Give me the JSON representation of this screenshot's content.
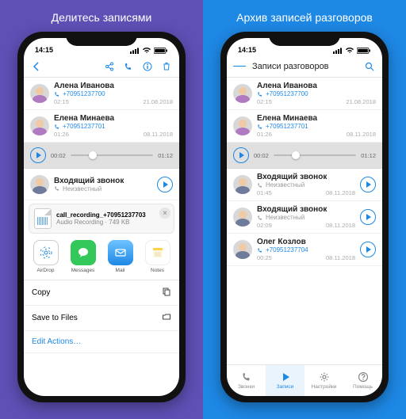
{
  "panels": {
    "left_title": "Делитесь записями",
    "right_title": "Архив записей разговоров"
  },
  "status_time": "14:15",
  "colors": {
    "accent": "#1e88e5"
  },
  "left": {
    "recordings": [
      {
        "name": "Алена Иванова",
        "phone": "+70951237700",
        "dur": "02:15",
        "date": "21.08.2018",
        "avatar": "f"
      },
      {
        "name": "Елена Минаева",
        "phone": "+70951237701",
        "dur": "01:26",
        "date": "08.11.2018",
        "avatar": "f"
      }
    ],
    "player": {
      "pos": "00:02",
      "total": "01:12"
    },
    "incoming": {
      "name": "Входящий звонок",
      "sub": "Неизвестный"
    },
    "share_file": {
      "title": "call_recording_+70951237703",
      "subtitle": "Audio Recording · 749 KB"
    },
    "share_apps": [
      {
        "key": "airdrop",
        "label": "AirDrop"
      },
      {
        "key": "messages",
        "label": "Messages"
      },
      {
        "key": "mail",
        "label": "Mail"
      },
      {
        "key": "notes",
        "label": "Notes"
      }
    ],
    "actions": {
      "copy": "Copy",
      "save": "Save to Files",
      "edit": "Edit Actions…"
    }
  },
  "right": {
    "header_title": "Записи разговоров",
    "recordings": [
      {
        "name": "Алена Иванова",
        "phone": "+70951237700",
        "dur": "02:15",
        "date": "21.08.2018",
        "avatar": "f",
        "play": false
      },
      {
        "name": "Елена Минаева",
        "phone": "+70951237701",
        "dur": "01:26",
        "date": "08.11.2018",
        "avatar": "f",
        "play": false
      },
      {
        "name": "Входящий звонок",
        "phone": "Неизвестный",
        "dur": "01:45",
        "date": "08.11.2018",
        "avatar": "m",
        "play": true,
        "gray": true
      },
      {
        "name": "Входящий звонок",
        "phone": "Неизвестный",
        "dur": "02:09",
        "date": "08.11.2018",
        "avatar": "m",
        "play": true,
        "gray": true
      },
      {
        "name": "Олег Козлов",
        "phone": "+70951237704",
        "dur": "00:25",
        "date": "08.11.2018",
        "avatar": "m",
        "play": true
      }
    ],
    "player": {
      "pos": "00:02",
      "total": "01:12"
    },
    "tabs": [
      {
        "key": "calls",
        "label": "Звонки"
      },
      {
        "key": "records",
        "label": "Записи"
      },
      {
        "key": "settings",
        "label": "Настройки"
      },
      {
        "key": "help",
        "label": "Помощь"
      }
    ]
  }
}
